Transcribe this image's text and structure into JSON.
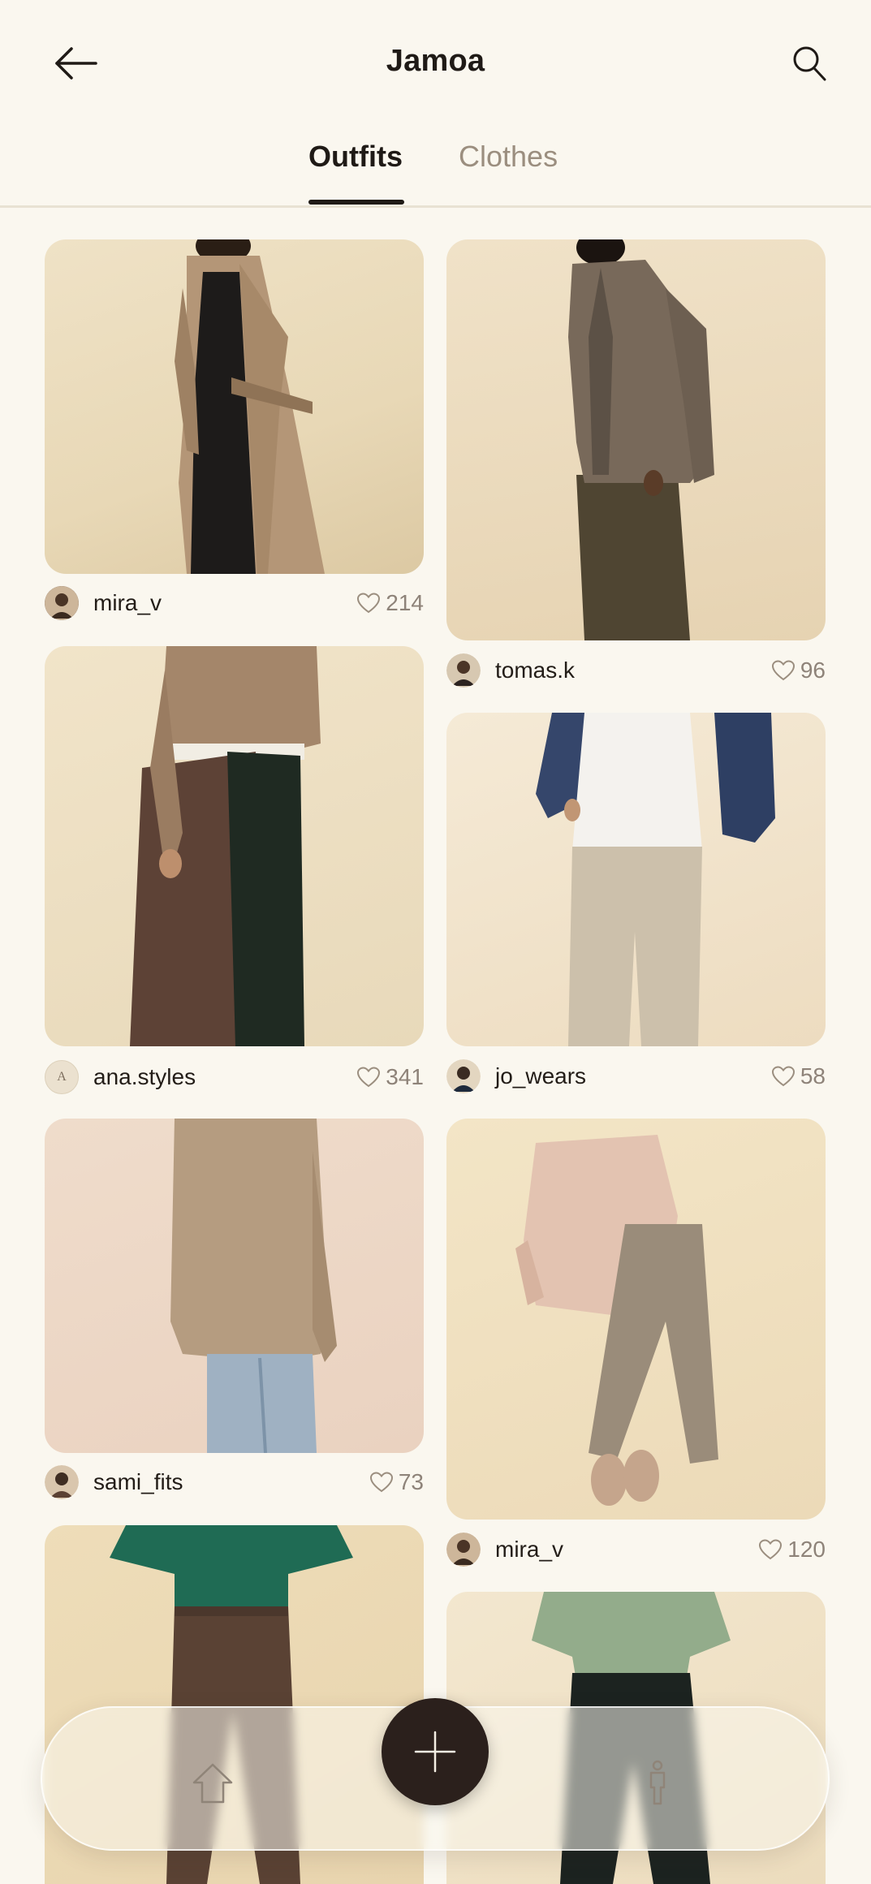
{
  "app": {
    "title": "Jamoa"
  },
  "tabs": [
    {
      "label": "Outfits",
      "active": true
    },
    {
      "label": "Clothes",
      "active": false
    }
  ],
  "posts": [
    {
      "user": "mira_v",
      "likes": "214"
    },
    {
      "user": "tomas.k",
      "likes": "96"
    },
    {
      "user": "ana.styles",
      "likes": "341",
      "avatar_initial": "A"
    },
    {
      "user": "jo_wears",
      "likes": "58"
    },
    {
      "user": "sami_fits",
      "likes": "73"
    },
    {
      "user": "mira_v",
      "likes": "120"
    }
  ],
  "icons": {
    "back": "arrow-left-icon",
    "search": "search-icon",
    "like": "heart-icon",
    "home": "home-icon",
    "add": "plus-icon",
    "profile": "person-icon"
  },
  "colors": {
    "background": "#faf7ef",
    "text": "#1f1a16",
    "muted": "#9b8e7f",
    "fab": "#2b201c"
  }
}
